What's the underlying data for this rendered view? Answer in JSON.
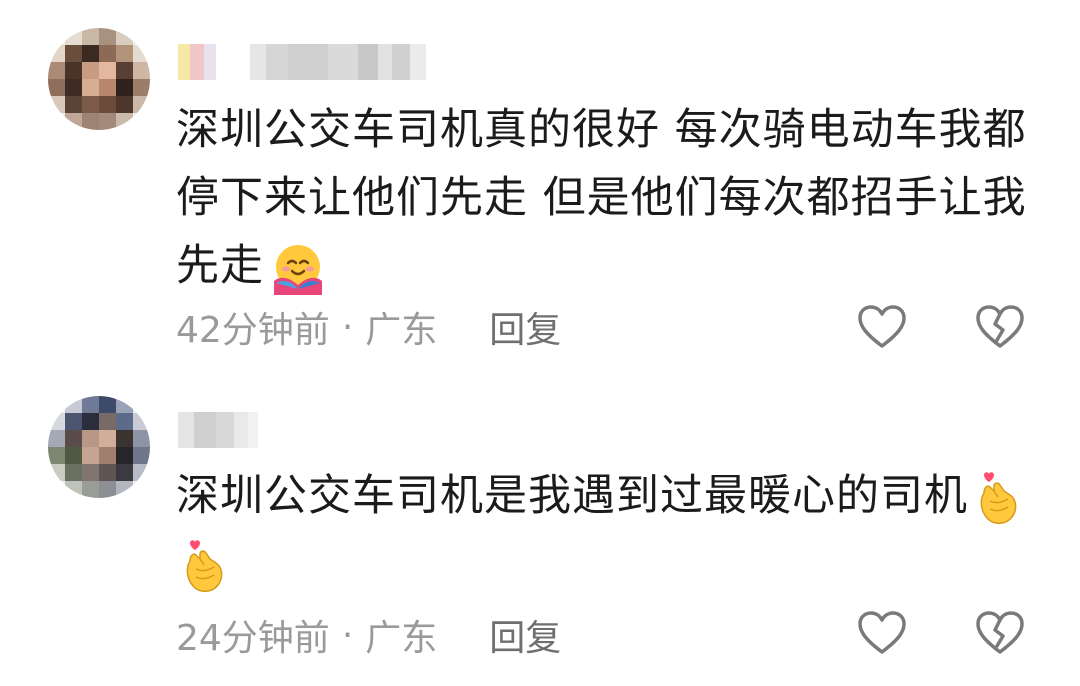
{
  "comments": [
    {
      "text_line1": "深圳公交车司机真的很好 每次骑电动车我都",
      "text_line2": "停下来让他们先走 但是他们每次都招手让我",
      "text_line3": "先走",
      "emoji": "hugging-face-emoji",
      "time": "42分钟前",
      "separator": "·",
      "location": "广东",
      "reply": "回复",
      "like_icon": "heart-outline-icon",
      "dislike_icon": "broken-heart-icon"
    },
    {
      "text_line1": "深圳公交车司机是我遇到过最暖心的司机",
      "emoji": "finger-heart-emoji",
      "time": "24分钟前",
      "separator": "·",
      "location": "广东",
      "reply": "回复",
      "like_icon": "heart-outline-icon",
      "dislike_icon": "broken-heart-icon"
    }
  ],
  "colors": {
    "text": "#1b1b1b",
    "meta": "#9a9a9a",
    "icon": "#7a7a7a"
  }
}
